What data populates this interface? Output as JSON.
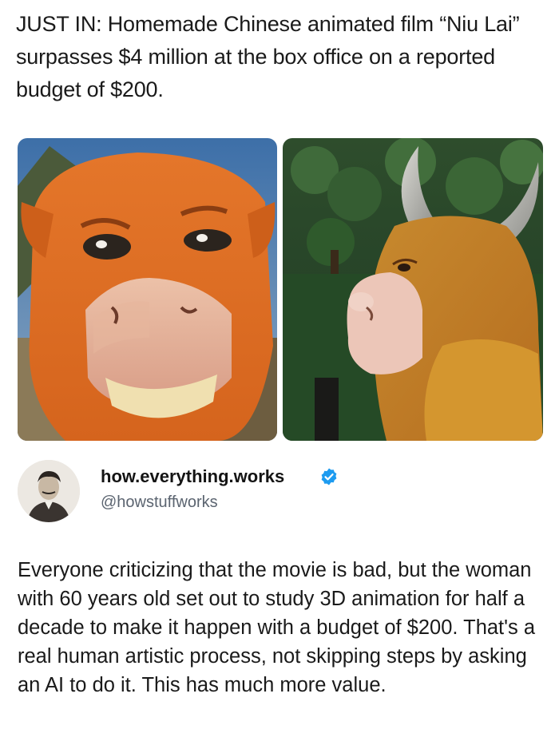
{
  "headline": "JUST IN: Homemade Chinese animated film “Niu Lai” surpasses $4 million at the box office on a reported budget of $200.",
  "images": [
    {
      "icon": "cartoon-bull-face-image"
    },
    {
      "icon": "cartoon-bull-profile-image"
    }
  ],
  "author": {
    "display_name": "how.everything.works",
    "handle": "@howstuffworks",
    "verified_color": "#1d9bf0"
  },
  "post_text": "Everyone criticizing that the movie is bad, but the woman with 60 years old set out to study 3D animation for half a decade to make it happen with a budget of $200. That's a real human artistic process, not skipping steps by asking an AI to do it. This has much more value."
}
